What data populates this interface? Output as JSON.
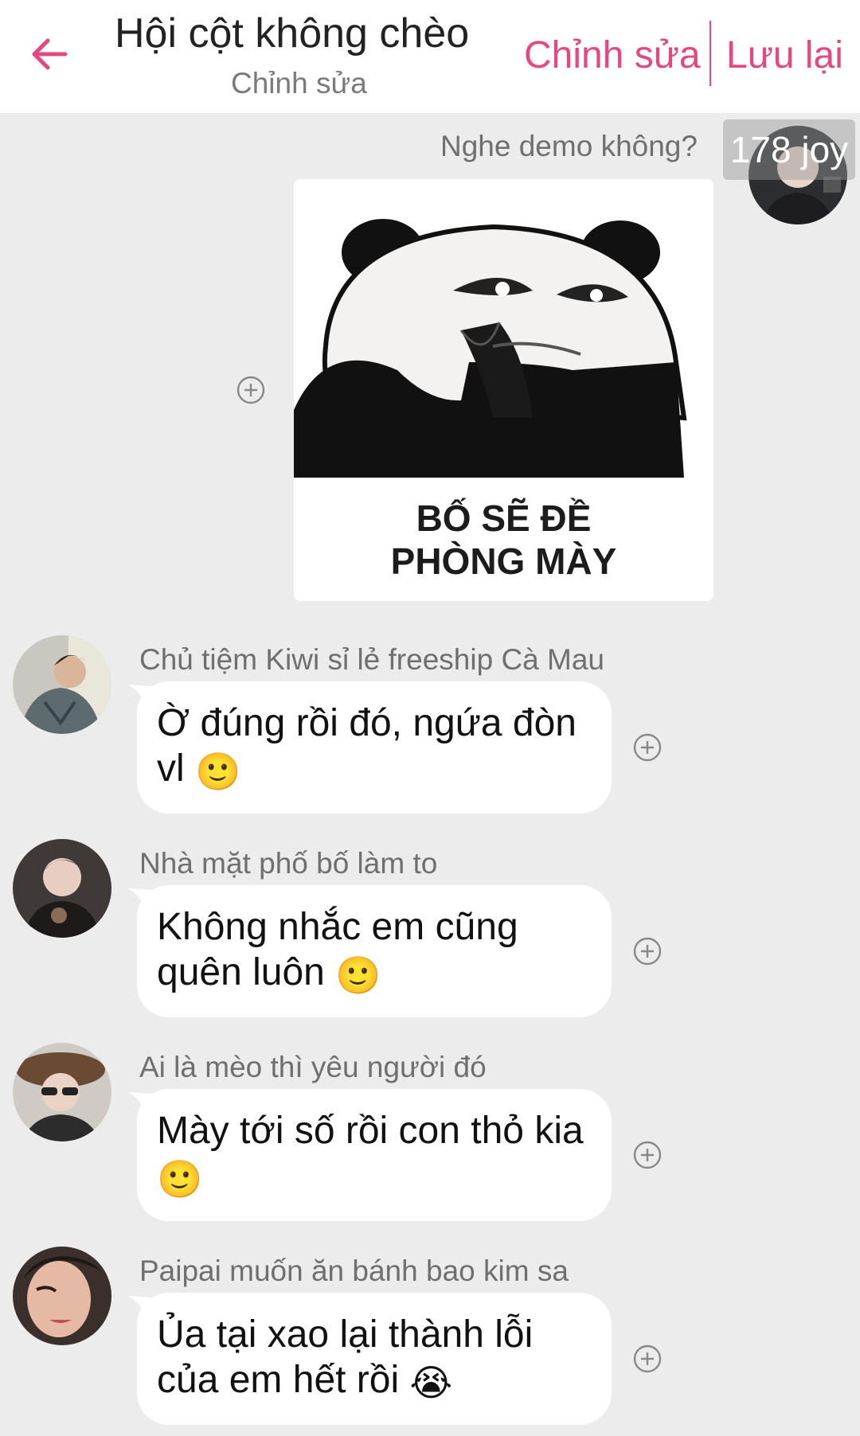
{
  "header": {
    "title": "Hội cột không chèo",
    "subtitle": "Chỉnh sửa",
    "edit_label": "Chỉnh sửa",
    "save_label": "Lưu lại",
    "back_icon": "arrow-left-icon",
    "accent_color": "#e5487f"
  },
  "messages": [
    {
      "sender": "Nghe demo không?",
      "badge": "178 joy",
      "type": "image",
      "image_caption_line1": "BỐ SẼ ĐỀ",
      "image_caption_line2": "PHÒNG MÀY"
    },
    {
      "sender": "Chủ tiệm Kiwi sỉ lẻ freeship Cà Mau",
      "line1": "Ờ đúng rồi đó, ngứa đòn",
      "line2": "vl",
      "emoji": "🙂"
    },
    {
      "sender": "Nhà mặt phố bố làm to",
      "line1": "Không nhắc em cũng",
      "line2": "quên luôn",
      "emoji": "🙂"
    },
    {
      "sender": "Ai là mèo thì yêu người đó",
      "line1": "Mày tới số rồi con thỏ kia",
      "line2": "",
      "emoji": "🙂"
    },
    {
      "sender": "Paipai muốn ăn bánh bao kim sa",
      "line1": "Ủa tại xao lại thành lỗi",
      "line2": "của em hết rồi",
      "emoji": "😭"
    }
  ]
}
